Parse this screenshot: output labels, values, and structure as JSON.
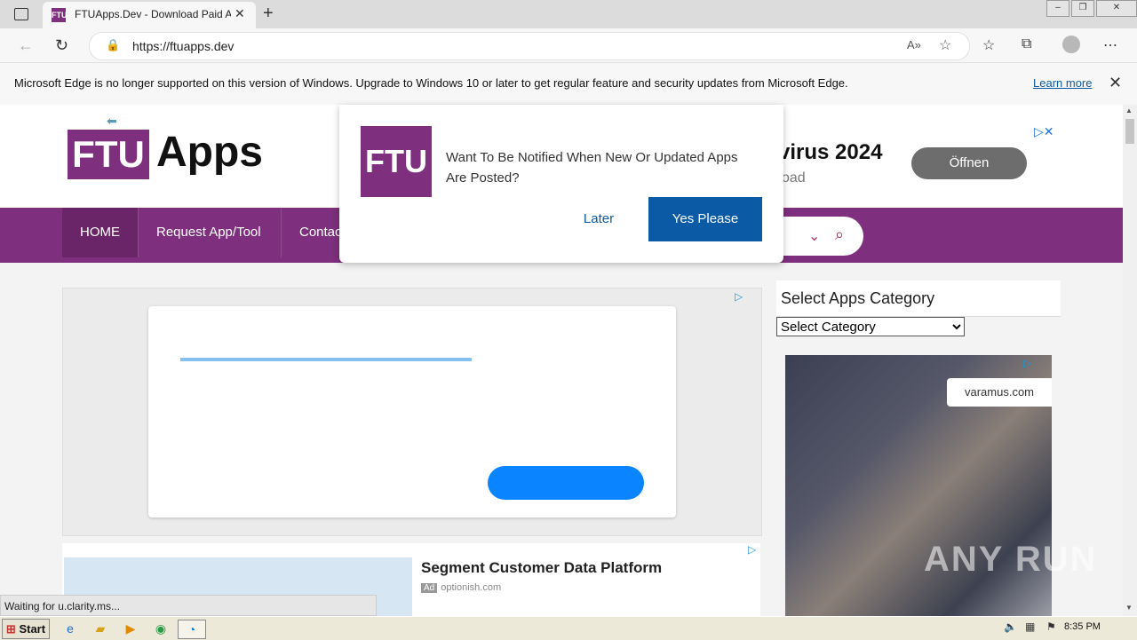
{
  "browser": {
    "tab_title": "FTUApps.Dev - Download Paid A",
    "tab_favicon": "FTU",
    "url": "https://ftuapps.dev",
    "icons": [
      "back-icon",
      "refresh-icon",
      "lock-icon",
      "read-aloud-icon",
      "add-favorite-icon",
      "favorites-icon",
      "collections-icon",
      "profile-icon",
      "more-icon"
    ]
  },
  "infobar": {
    "message": "Microsoft Edge is no longer supported on this version of Windows. Upgrade to Windows 10 or later to get regular feature and security updates from Microsoft Edge.",
    "link": "Learn more"
  },
  "site": {
    "logo_left": "FTU",
    "logo_right": "Apps",
    "nav": [
      "HOME",
      "Request App/Tool",
      "Contac"
    ],
    "banner_ad": {
      "title": "virus 2024",
      "subtitle": "oad",
      "button": "Öffnen"
    }
  },
  "popup": {
    "logo": "FTU",
    "message": "Want To Be Notified When New Or Updated Apps Are Posted?",
    "later": "Later",
    "yes": "Yes Please"
  },
  "ads": {
    "secondary": {
      "title": "Segment Customer Data Platform",
      "badge": "Ad",
      "source": "optionish.com"
    },
    "side": {
      "label": "varamus.com"
    }
  },
  "sidebar": {
    "title": "Select Apps Category",
    "select_value": "Select Category"
  },
  "status": "Waiting for u.clarity.ms...",
  "watermark": "ANY RUN",
  "taskbar": {
    "start": "Start",
    "clock": "8:35 PM"
  },
  "colors": {
    "brand": "#7e2f7d",
    "accent": "#0b5aa6"
  }
}
